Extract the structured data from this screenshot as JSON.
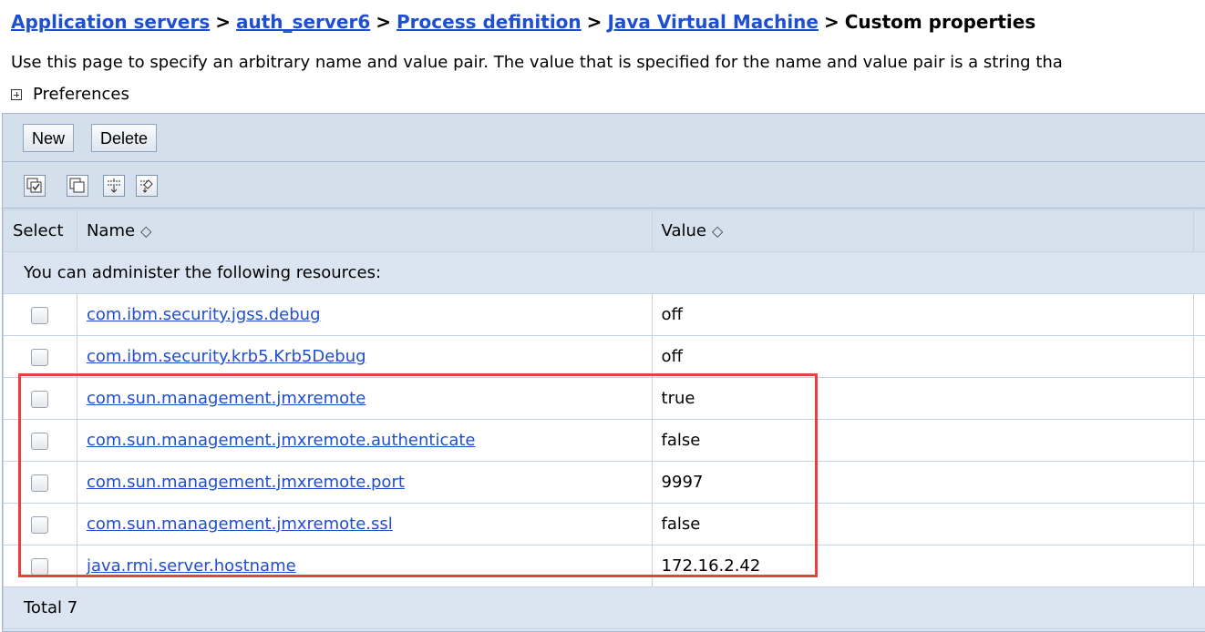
{
  "breadcrumb": {
    "items": [
      "Application servers",
      "auth_server6",
      "Process definition",
      "Java Virtual Machine"
    ],
    "separator": ">",
    "current": "Custom properties"
  },
  "description": "Use this page to specify an arbitrary name and value pair. The value that is specified for the name and value pair is a string tha",
  "preferences_label": "Preferences",
  "toolbar": {
    "new_label": "New",
    "delete_label": "Delete"
  },
  "icons": [
    "select-all-icon",
    "deselect-all-icon",
    "show-filter-icon",
    "clear-filter-icon"
  ],
  "table": {
    "columns": {
      "select": "Select",
      "name": "Name",
      "value": "Value",
      "sort_glyph": "◇"
    },
    "message": "You can administer the following resources:",
    "rows": [
      {
        "name": "com.ibm.security.jgss.debug",
        "value": "off"
      },
      {
        "name": "com.ibm.security.krb5.Krb5Debug",
        "value": "off"
      },
      {
        "name": "com.sun.management.jmxremote",
        "value": "true"
      },
      {
        "name": "com.sun.management.jmxremote.authenticate",
        "value": "false"
      },
      {
        "name": "com.sun.management.jmxremote.port",
        "value": "9997"
      },
      {
        "name": "com.sun.management.jmxremote.ssl",
        "value": "false"
      },
      {
        "name": "java.rmi.server.hostname",
        "value": "172.16.2.42"
      }
    ],
    "total": "Total 7"
  },
  "colors": {
    "link": "#1f4fd0",
    "highlight": "#e8403f",
    "panel": "#dbe5f1"
  }
}
